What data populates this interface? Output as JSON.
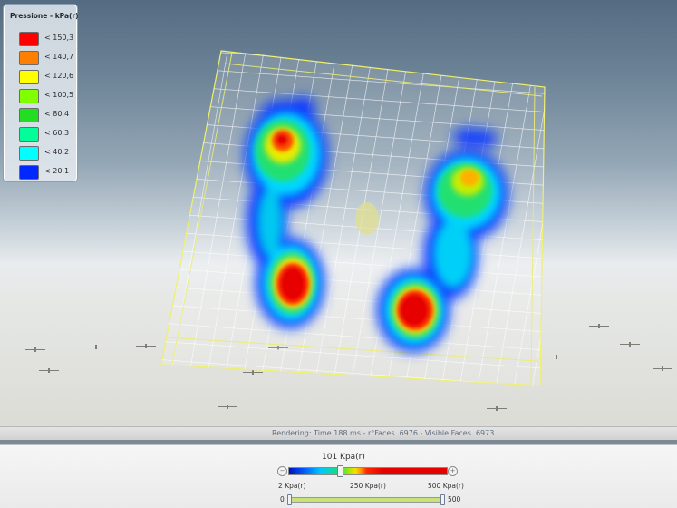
{
  "legend": {
    "title": "Pressione - kPa(r)",
    "items": [
      {
        "label": "< 150,3",
        "color": "#ff0000"
      },
      {
        "label": "< 140,7",
        "color": "#ff7f00"
      },
      {
        "label": "< 120,6",
        "color": "#ffff00"
      },
      {
        "label": "< 100,5",
        "color": "#80ff00"
      },
      {
        "label": "< 80,4",
        "color": "#22dd22"
      },
      {
        "label": "< 60,3",
        "color": "#00ff99"
      },
      {
        "label": "< 40,2",
        "color": "#00ffff"
      },
      {
        "label": "< 20,1",
        "color": "#0028ff"
      }
    ]
  },
  "status": {
    "text": "Rendering: Time 188 ms - r°Faces .6976 - Visible Faces .6973"
  },
  "pressure_scale": {
    "current_value_label": "101 Kpa(r)",
    "min_label": "2 Kpa(r)",
    "mid_label": "250 Kpa(r)",
    "max_label": "500 Kpa(r)",
    "thumb_fraction": 0.32
  },
  "range": {
    "min_label": "0",
    "max_label": "500",
    "fill_fraction": 1.0
  },
  "icons": {
    "decrement": "minus-circle-icon",
    "increment": "plus-circle-icon"
  }
}
